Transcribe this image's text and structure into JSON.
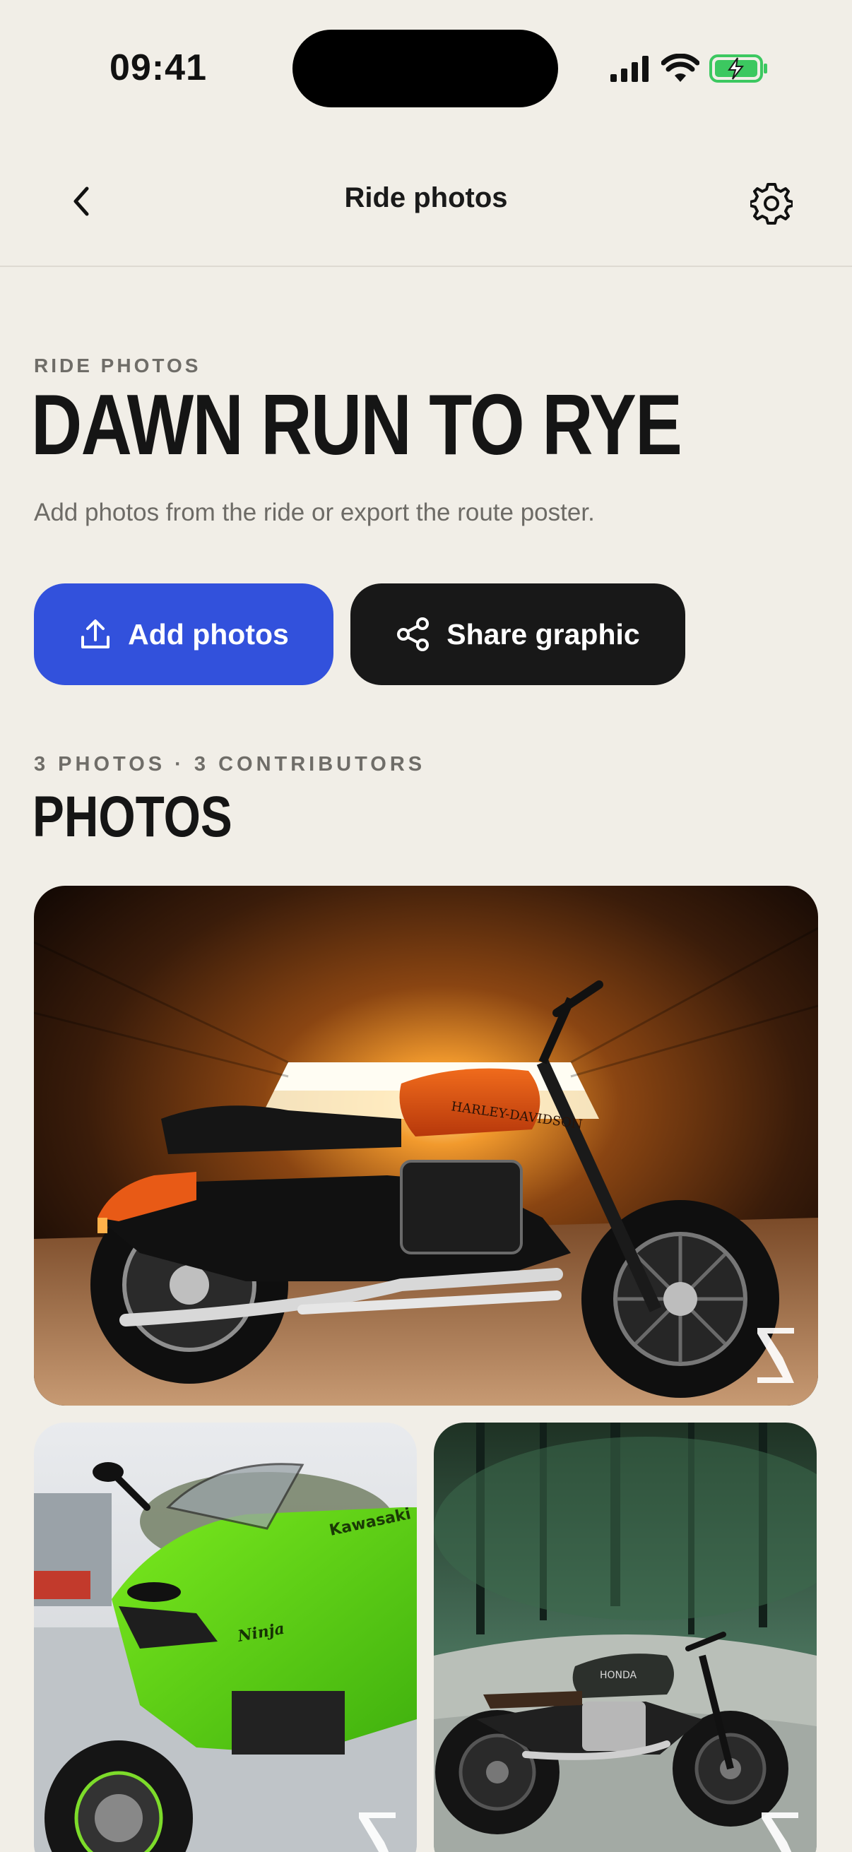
{
  "status_bar": {
    "time": "09:41"
  },
  "nav": {
    "title": "Ride photos"
  },
  "header": {
    "eyebrow": "RIDE PHOTOS",
    "title": "DAWN RUN TO RYE",
    "subtitle": "Add photos from the ride or export the route poster."
  },
  "actions": {
    "add_label": "Add photos",
    "share_label": "Share graphic"
  },
  "photos_section": {
    "meta": "3 PHOTOS · 3 CONTRIBUTORS",
    "title": "PHOTOS",
    "items": [
      {
        "caption": "HARLEY-DAVIDSON"
      },
      {
        "caption": "Kawasaki",
        "caption2": "Ninja"
      },
      {
        "caption": "HONDA"
      }
    ]
  },
  "colors": {
    "accent": "#3251dc",
    "dark": "#181818",
    "background": "#f1eee7",
    "battery": "#3cc860"
  }
}
